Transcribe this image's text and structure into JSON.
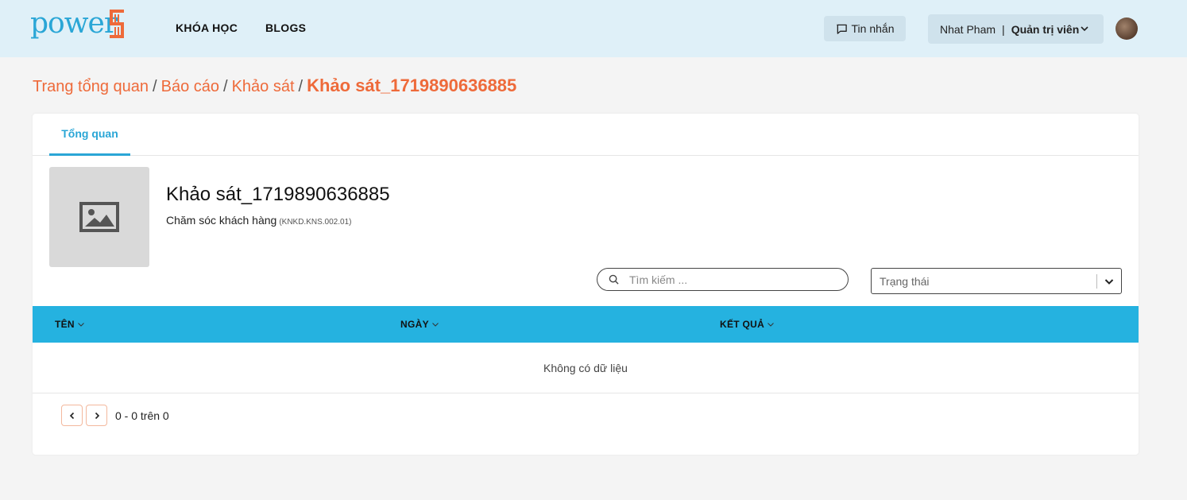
{
  "header": {
    "logo_text": "power",
    "nav": [
      "KHÓA HỌC",
      "BLOGS"
    ],
    "messages_label": "Tin nhắn",
    "user_name": "Nhat Pham",
    "user_separator": "|",
    "user_role": "Quản trị viên"
  },
  "breadcrumb": {
    "items": [
      "Trang tổng quan",
      "Báo cáo",
      "Khảo sát"
    ],
    "separator": "/",
    "current": "Khảo sát_1719890636885"
  },
  "tabs": [
    "Tổng quan"
  ],
  "survey": {
    "title": "Khảo sát_1719890636885",
    "course": "Chăm sóc khách hàng",
    "code": "(KNKD.KNS.002.01)"
  },
  "filters": {
    "search_placeholder": "Tìm kiếm ...",
    "status_placeholder": "Trạng thái"
  },
  "table": {
    "columns": [
      "TÊN",
      "NGÀY",
      "KẾT QUẢ"
    ],
    "empty_text": "Không có dữ liệu"
  },
  "pagination": {
    "info": "0 - 0 trên 0"
  },
  "colors": {
    "accent_orange": "#ee6a3a",
    "accent_blue": "#2aa6d6",
    "table_header": "#25b2e0",
    "header_bg": "#dff0f8"
  }
}
